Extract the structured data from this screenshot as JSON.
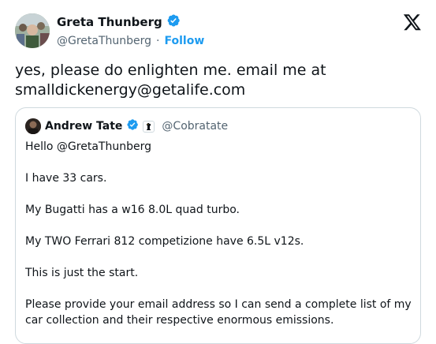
{
  "author": {
    "name": "Greta Thunberg",
    "handle": "@GretaThunberg",
    "separator": "·",
    "follow_label": "Follow",
    "verified_icon": "verified-badge-icon"
  },
  "tweet": {
    "text_line1": "yes, please do enlighten me. email me at",
    "text_line2": "smalldickenergy@getalife.com"
  },
  "quoted": {
    "name": "Andrew Tate",
    "handle": "@Cobratate",
    "paragraphs": [
      "Hello @GretaThunberg",
      "I have 33 cars.",
      "My Bugatti has a w16 8.0L quad turbo.",
      "My TWO Ferrari 812 competizione have 6.5L v12s.",
      "This is just the start.",
      "Please provide your email address so I can send a complete list of my car collection and their respective enormous emissions."
    ]
  },
  "colors": {
    "accent": "#1d9bf0",
    "secondary_text": "#536471",
    "border": "#cfd9de"
  },
  "icons": [
    "x-logo-icon",
    "verified-badge-icon",
    "affiliate-badge-icon"
  ]
}
